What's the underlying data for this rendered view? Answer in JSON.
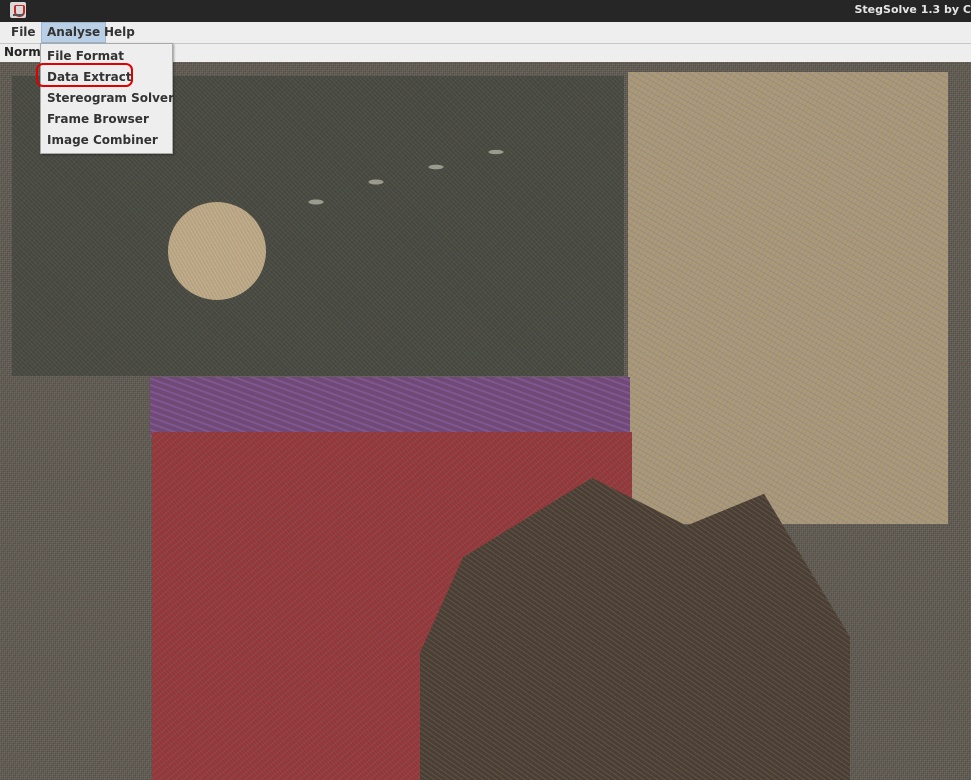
{
  "window": {
    "title": "StegSolve 1.3 by C"
  },
  "menubar": {
    "items": [
      "File",
      "Analyse",
      "Help"
    ],
    "active": "Analyse"
  },
  "view": {
    "mode_label": "Norm"
  },
  "analyse_menu": {
    "items": [
      "File Format",
      "Data Extract",
      "Stereogram Solver",
      "Frame Browser",
      "Image Combiner"
    ],
    "highlighted": "Data Extract"
  },
  "colors": {
    "highlight_ring": "#e00000",
    "menu_active": "#b8cfe5"
  }
}
